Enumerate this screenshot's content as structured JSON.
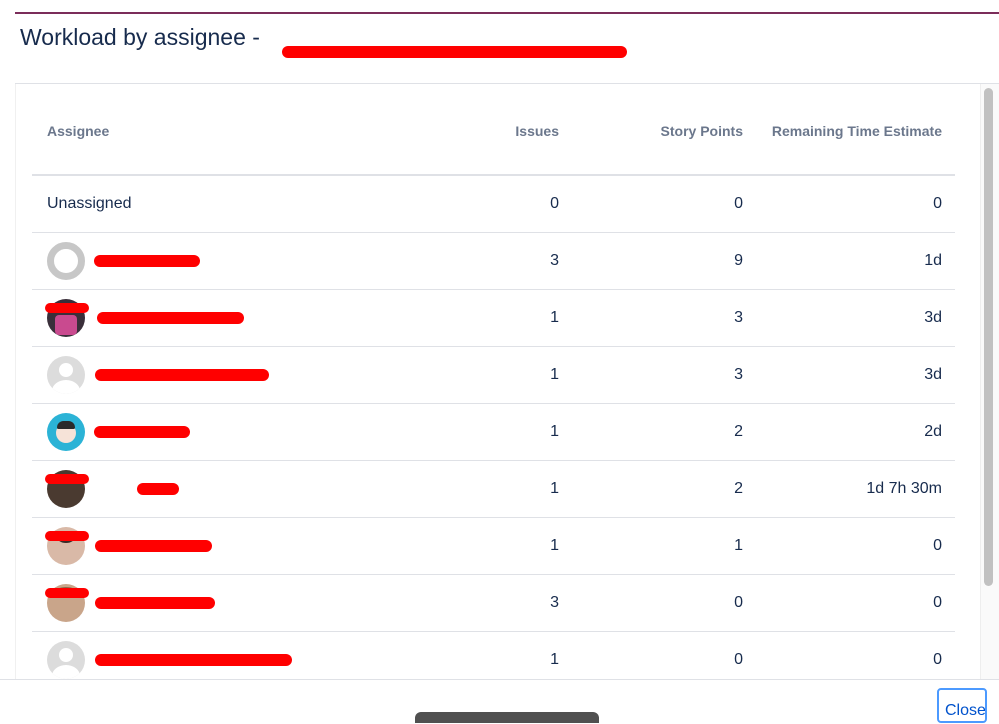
{
  "dialog": {
    "title": "Workload by assignee - "
  },
  "table": {
    "headers": {
      "assignee": "Assignee",
      "issues": "Issues",
      "story_points": "Story Points",
      "remaining": "Remaining Time Estimate"
    },
    "rows": [
      {
        "name": "Unassigned",
        "issues": "0",
        "story_points": "0",
        "remaining": "0"
      },
      {
        "name": "",
        "issues": "3",
        "story_points": "9",
        "remaining": "1d"
      },
      {
        "name": "",
        "issues": "1",
        "story_points": "3",
        "remaining": "3d"
      },
      {
        "name": "",
        "issues": "1",
        "story_points": "3",
        "remaining": "3d"
      },
      {
        "name": "",
        "issues": "1",
        "story_points": "2",
        "remaining": "2d"
      },
      {
        "name": "",
        "issues": "1",
        "story_points": "2",
        "remaining": "1d 7h 30m"
      },
      {
        "name": "",
        "issues": "1",
        "story_points": "1",
        "remaining": "0"
      },
      {
        "name": "",
        "issues": "3",
        "story_points": "0",
        "remaining": "0"
      },
      {
        "name": "",
        "issues": "1",
        "story_points": "0",
        "remaining": "0"
      }
    ]
  },
  "footer": {
    "close_label": "Close"
  },
  "colors": {
    "accent": "#7b2d5a",
    "redaction": "#ff0000",
    "close_border": "#4c9aff"
  }
}
